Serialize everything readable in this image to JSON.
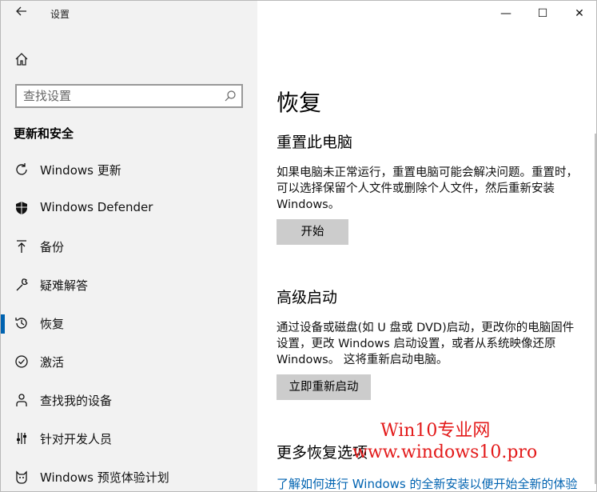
{
  "window": {
    "title": "设置",
    "back_icon": "back-arrow-icon",
    "controls": {
      "minimize": "—",
      "maximize": "☐",
      "close": "✕"
    }
  },
  "sidebar": {
    "home_icon": "home-icon",
    "search": {
      "placeholder": "查找设置",
      "icon": "search-icon"
    },
    "section_title": "更新和安全",
    "items": [
      {
        "label": "Windows 更新",
        "icon": "refresh-icon",
        "active": false
      },
      {
        "label": "Windows Defender",
        "icon": "shield-icon",
        "active": false
      },
      {
        "label": "备份",
        "icon": "upload-icon",
        "active": false
      },
      {
        "label": "疑难解答",
        "icon": "wrench-icon",
        "active": false
      },
      {
        "label": "恢复",
        "icon": "history-icon",
        "active": true
      },
      {
        "label": "激活",
        "icon": "check-circle-icon",
        "active": false
      },
      {
        "label": "查找我的设备",
        "icon": "person-icon",
        "active": false
      },
      {
        "label": "针对开发人员",
        "icon": "sliders-icon",
        "active": false
      },
      {
        "label": "Windows 预览体验计划",
        "icon": "cat-icon",
        "active": false
      }
    ]
  },
  "main": {
    "title": "恢复",
    "reset": {
      "heading": "重置此电脑",
      "description": "如果电脑未正常运行，重置电脑可能会解决问题。重置时，可以选择保留个人文件或删除个人文件，然后重新安装 Windows。",
      "button": "开始"
    },
    "advanced": {
      "heading": "高级启动",
      "description": "通过设备或磁盘(如 U 盘或 DVD)启动，更改你的电脑固件设置，更改 Windows 启动设置，或者从系统映像还原 Windows。 这将重新启动电脑。",
      "button": "立即重新启动"
    },
    "more": {
      "heading": "更多恢复选项",
      "link": "了解如何进行 Windows 的全新安装以便开始全新的体验"
    }
  },
  "watermark": {
    "line1": "Win10专业网",
    "line2": "www.windows10.pro"
  },
  "colors": {
    "accent": "#0063b1",
    "sidebar_bg": "#f2f2f2",
    "button_bg": "#cccccc",
    "watermark": "#e31a1a"
  }
}
